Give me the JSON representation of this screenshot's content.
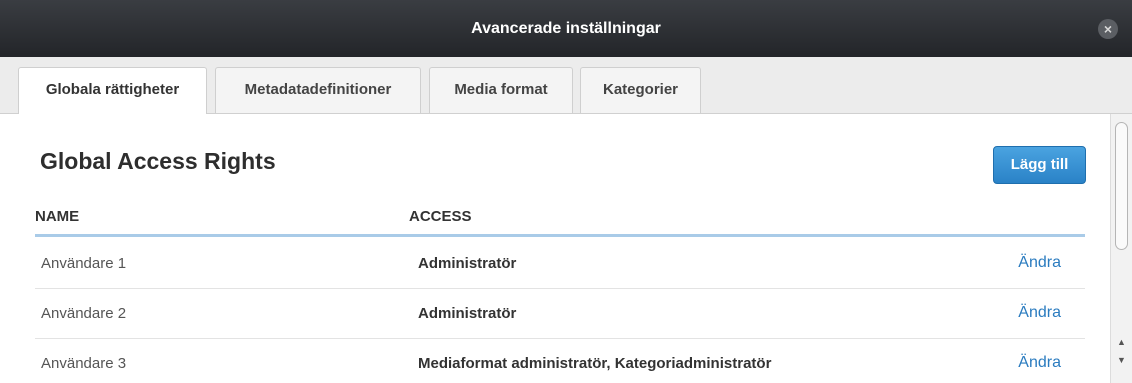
{
  "window": {
    "title": "Avancerade inställningar",
    "close_icon": "×"
  },
  "tabs": [
    {
      "label": "Globala rättigheter",
      "active": true
    },
    {
      "label": "Metadatadefinitioner",
      "active": false
    },
    {
      "label": "Media format",
      "active": false
    },
    {
      "label": "Kategorier",
      "active": false
    }
  ],
  "main": {
    "title": "Global Access Rights",
    "add_label": "Lägg till",
    "columns": {
      "name": "NAME",
      "access": "ACCESS"
    },
    "rows": [
      {
        "name": "Användare 1",
        "access": "Administratör",
        "action": "Ändra"
      },
      {
        "name": "Användare 2",
        "access": "Administratör",
        "action": "Ändra"
      },
      {
        "name": "Användare 3",
        "access": "Mediaformat administratör, Kategoriadministratör",
        "action": "Ändra"
      }
    ]
  },
  "scrollbar": {
    "up_icon": "▲",
    "down_icon": "▼"
  },
  "colors": {
    "titlebar": "#2b2d31",
    "accent_button": "#2a82c7",
    "link": "#2a7bbf",
    "header_rule": "#a9cbe8"
  }
}
